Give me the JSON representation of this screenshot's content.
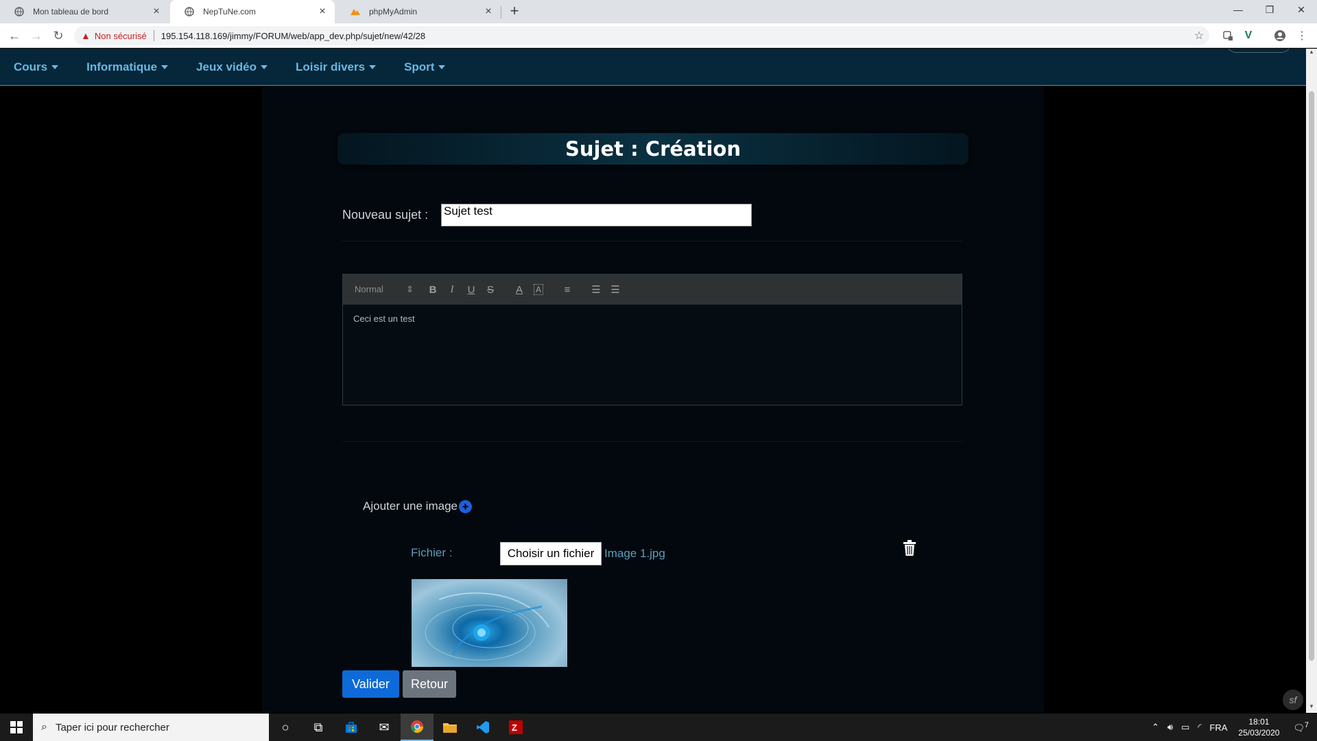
{
  "browser": {
    "tabs": [
      {
        "title": "Mon tableau de bord",
        "active": false
      },
      {
        "title": "NepTuNe.com",
        "active": true
      },
      {
        "title": "phpMyAdmin",
        "active": false
      }
    ],
    "security_label": "Non sécurisé",
    "url": "195.154.118.169/jimmy/FORUM/web/app_dev.php/sujet/new/42/28"
  },
  "nav": {
    "items": [
      {
        "label": "Cours"
      },
      {
        "label": "Informatique"
      },
      {
        "label": "Jeux vidéo"
      },
      {
        "label": "Loisir divers"
      },
      {
        "label": "Sport"
      }
    ]
  },
  "form": {
    "title": "Sujet : Création",
    "subject_label": "Nouveau sujet :",
    "subject_value": "Sujet test",
    "editor": {
      "format_select": "Normal",
      "content": "Ceci est un test"
    },
    "add_image_label": "Ajouter une image",
    "file_label": "Fichier :",
    "file_button": "Choisir un fichier",
    "file_name": "Image 1.jpg",
    "submit_label": "Valider",
    "back_label": "Retour"
  },
  "taskbar": {
    "search_placeholder": "Taper ici pour rechercher",
    "language": "FRA",
    "time": "18:01",
    "date": "25/03/2020",
    "notification_count": "7"
  },
  "colors": {
    "nav_bg": "#052739",
    "nav_text": "#6bb7e4",
    "primary_button": "#0d6ad8",
    "secondary_button": "#6c757d"
  }
}
